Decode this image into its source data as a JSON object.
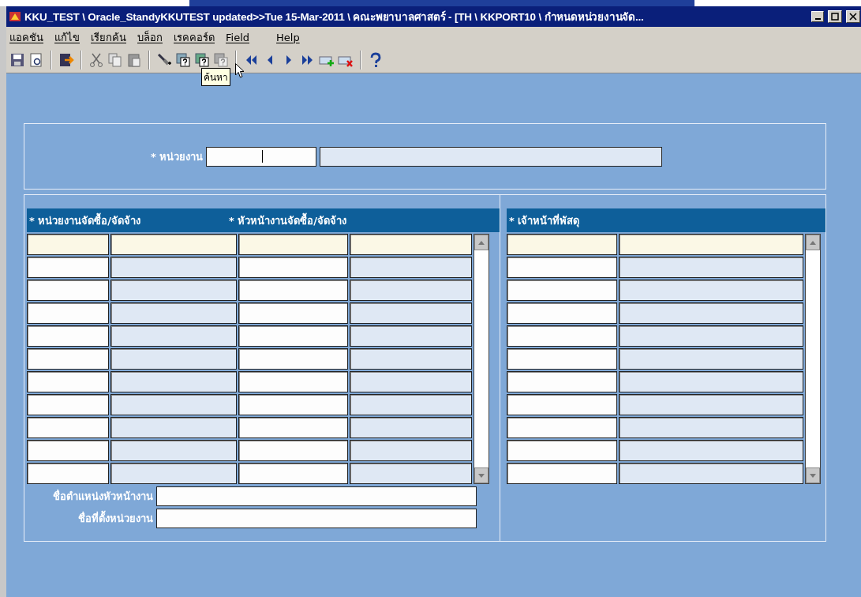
{
  "window": {
    "title": "KKU_TEST \\ Oracle_StandyKKUTEST updated>>Tue 15-Mar-2011 \\ คณะพยาบาลศาสตร์ - [TH \\ KKPORT10 \\ กำหนดหน่วยงานจัด..."
  },
  "menu": [
    "แอคชัน",
    "แก้ไข",
    "เรียกค้น",
    "บล็อก",
    "เรคคอร์ด",
    "Field",
    "Help"
  ],
  "toolbar": {
    "tooltip": "ค้นหา"
  },
  "unit_field": {
    "label": "* หน่วยงาน"
  },
  "procurement_block": {
    "headers": [
      "* หน่วยงานจัดซื้อ/จัดจ้าง",
      "* หัวหน้างานจัดซื้อ/จัดจ้าง"
    ],
    "rows": [
      {
        "selected": true
      },
      {
        "selected": false
      },
      {
        "selected": false
      },
      {
        "selected": false
      },
      {
        "selected": false
      },
      {
        "selected": false
      },
      {
        "selected": false
      },
      {
        "selected": false
      },
      {
        "selected": false
      },
      {
        "selected": false
      },
      {
        "selected": false
      }
    ],
    "fields": [
      {
        "label": "ชื่อตำแหน่งหัวหน้างาน"
      },
      {
        "label": "ชื่อที่ตั้งหน่วยงาน"
      }
    ]
  },
  "supply_block": {
    "header": "* เจ้าหน้าที่พัสดุ",
    "rows": [
      {
        "selected": true
      },
      {
        "selected": false
      },
      {
        "selected": false
      },
      {
        "selected": false
      },
      {
        "selected": false
      },
      {
        "selected": false
      },
      {
        "selected": false
      },
      {
        "selected": false
      },
      {
        "selected": false
      },
      {
        "selected": false
      },
      {
        "selected": false
      }
    ]
  }
}
